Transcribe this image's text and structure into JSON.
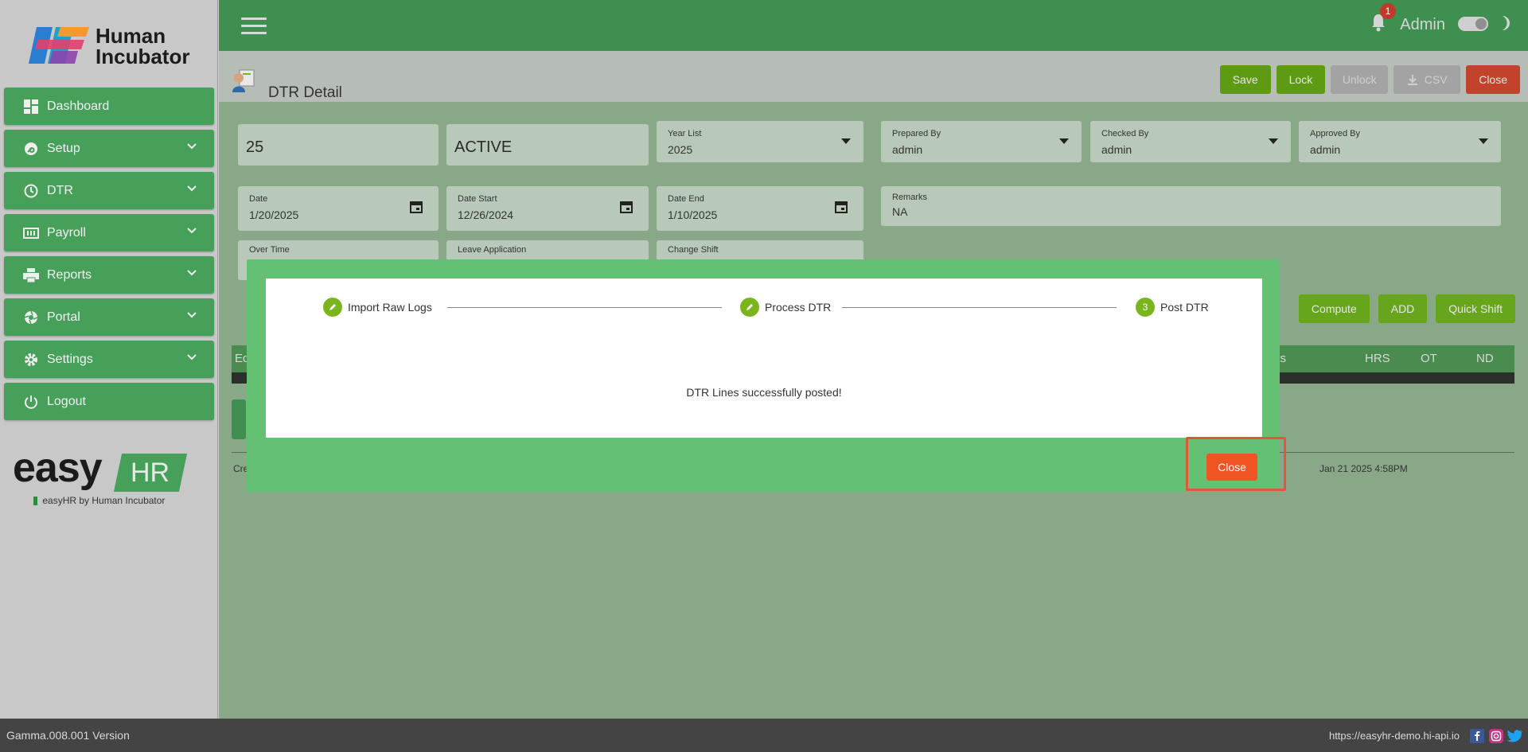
{
  "brand": {
    "logo_line1": "Human",
    "logo_line2": "Incubator",
    "easy": "easy",
    "hr": "HR",
    "tagline": "easyHR by Human Incubator"
  },
  "sidebar": {
    "items": [
      {
        "label": "Dashboard",
        "icon": "dashboard-icon",
        "expandable": false
      },
      {
        "label": "Setup",
        "icon": "wrench-icon",
        "expandable": true
      },
      {
        "label": "DTR",
        "icon": "clock-icon",
        "expandable": true
      },
      {
        "label": "Payroll",
        "icon": "money-icon",
        "expandable": true
      },
      {
        "label": "Reports",
        "icon": "printer-icon",
        "expandable": true
      },
      {
        "label": "Portal",
        "icon": "aperture-icon",
        "expandable": true
      },
      {
        "label": "Settings",
        "icon": "gear-icon",
        "expandable": true
      },
      {
        "label": "Logout",
        "icon": "power-icon",
        "expandable": false
      }
    ]
  },
  "header": {
    "notification_count": "1",
    "user": "Admin"
  },
  "page": {
    "title": "DTR Detail",
    "buttons": {
      "save": "Save",
      "lock": "Lock",
      "unlock": "Unlock",
      "csv": "CSV",
      "close": "Close"
    }
  },
  "form": {
    "id_value": "25",
    "status_value": "ACTIVE",
    "year_list": {
      "label": "Year List",
      "value": "2025"
    },
    "prepared_by": {
      "label": "Prepared By",
      "value": "admin"
    },
    "checked_by": {
      "label": "Checked By",
      "value": "admin"
    },
    "approved_by": {
      "label": "Approved By",
      "value": "admin"
    },
    "date": {
      "label": "Date",
      "value": "1/20/2025"
    },
    "date_start": {
      "label": "Date Start",
      "value": "12/26/2024"
    },
    "date_end": {
      "label": "Date End",
      "value": "1/10/2025"
    },
    "remarks": {
      "label": "Remarks",
      "value": "NA"
    },
    "over_time": {
      "label": "Over Time"
    },
    "leave_application": {
      "label": "Leave Application"
    },
    "change_shift": {
      "label": "Change Shift"
    }
  },
  "actions": {
    "compute": "Compute",
    "add": "ADD",
    "quick_shift": "Quick Shift"
  },
  "grid": {
    "first_col": "Ed",
    "cols": [
      "ks",
      "HRS",
      "OT",
      "ND"
    ]
  },
  "record": {
    "created_prefix": "Cre",
    "timestamp": "Jan 21 2025 4:58PM"
  },
  "modal": {
    "steps": [
      {
        "label": "Import Raw Logs",
        "marker": ""
      },
      {
        "label": "Process DTR",
        "marker": ""
      },
      {
        "label": "Post DTR",
        "marker": "3"
      }
    ],
    "message": "DTR Lines successfully posted!",
    "close": "Close"
  },
  "footer": {
    "version": "Gamma.008.001 Version",
    "url": "https://easyhr-demo.hi-api.io"
  },
  "colors": {
    "primary": "#46a05a",
    "modal_bg": "#64c073",
    "accent_red": "#f05423",
    "step_green": "#7ab51d"
  }
}
